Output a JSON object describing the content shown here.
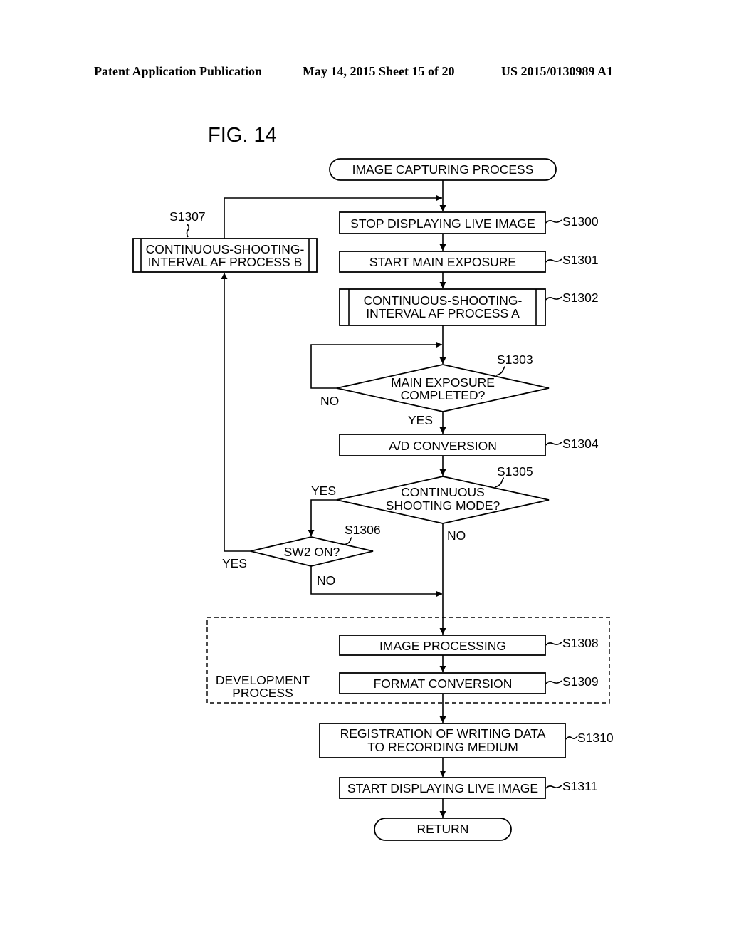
{
  "header": {
    "publication": "Patent Application Publication",
    "date_sheet": "May 14, 2015  Sheet 15 of 20",
    "number": "US 2015/0130989 A1"
  },
  "figure": {
    "title": "FIG. 14",
    "start": "IMAGE CAPTURING PROCESS",
    "end": "RETURN",
    "steps": {
      "s1300": {
        "id": "S1300",
        "lines": [
          "STOP DISPLAYING LIVE IMAGE"
        ]
      },
      "s1301": {
        "id": "S1301",
        "lines": [
          "START MAIN EXPOSURE"
        ]
      },
      "s1302": {
        "id": "S1302",
        "lines": [
          "CONTINUOUS-SHOOTING-",
          "INTERVAL AF PROCESS A"
        ]
      },
      "s1303": {
        "id": "S1303",
        "lines": [
          "MAIN EXPOSURE",
          "COMPLETED?"
        ],
        "yes": "YES",
        "no": "NO"
      },
      "s1304": {
        "id": "S1304",
        "lines": [
          "A/D CONVERSION"
        ]
      },
      "s1305": {
        "id": "S1305",
        "lines": [
          "CONTINUOUS",
          "SHOOTING MODE?"
        ],
        "yes": "YES",
        "no": "NO"
      },
      "s1306": {
        "id": "S1306",
        "lines": [
          "SW2 ON?"
        ],
        "yes": "YES",
        "no": "NO"
      },
      "s1307": {
        "id": "S1307",
        "lines": [
          "CONTINUOUS-SHOOTING-",
          "INTERVAL AF PROCESS B"
        ]
      },
      "s1308": {
        "id": "S1308",
        "lines": [
          "IMAGE PROCESSING"
        ]
      },
      "s1309": {
        "id": "S1309",
        "lines": [
          "FORMAT CONVERSION"
        ]
      },
      "s1310": {
        "id": "S1310",
        "lines": [
          "REGISTRATION OF WRITING DATA",
          "TO RECORDING MEDIUM"
        ]
      },
      "s1311": {
        "id": "S1311",
        "lines": [
          "START DISPLAYING LIVE IMAGE"
        ]
      }
    },
    "group": {
      "lines": [
        "DEVELOPMENT",
        "PROCESS"
      ]
    }
  }
}
